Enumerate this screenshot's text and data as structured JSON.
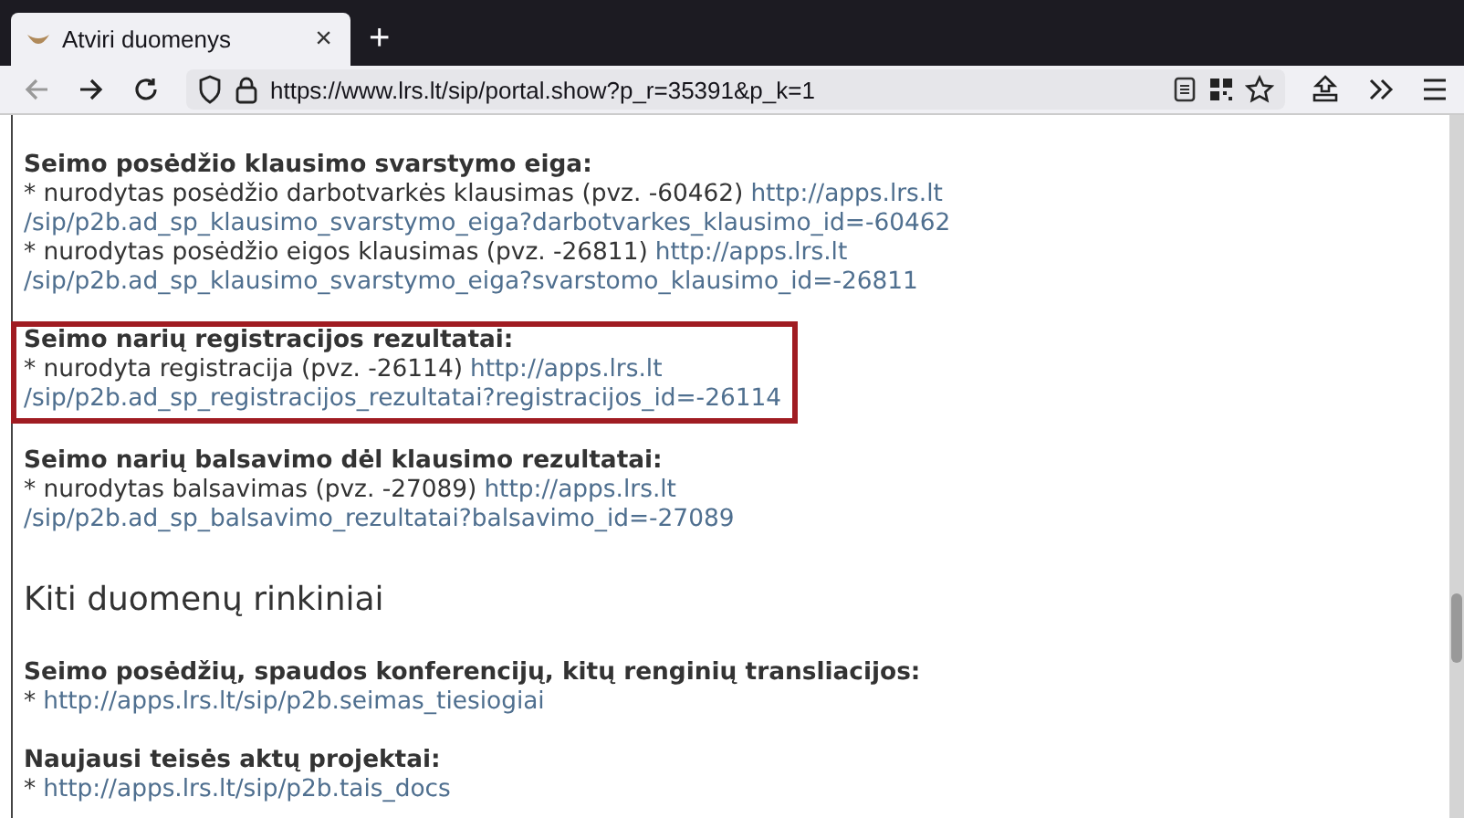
{
  "tab": {
    "title": "Atviri duomenys",
    "close": "×"
  },
  "new_tab": "+",
  "address_bar": {
    "url": "https://www.lrs.lt/sip/portal.show?p_r=35391&p_k=1"
  },
  "content": [
    {
      "kind": "section",
      "title": "Seimo posėdžio klausimo svarstymo eiga:",
      "items": [
        {
          "text": "* nurodytas posėdžio darbotvarkės klausimas (pvz. -60462)",
          "link_start": "http://apps.lrs.lt",
          "link_end": "/sip/p2b.ad_sp_klausimo_svarstymo_eiga?darbotvarkes_klausimo_id=-60462"
        },
        {
          "text": "* nurodytas posėdžio eigos klausimas (pvz. -26811)",
          "link_start": "http://apps.lrs.lt",
          "link_end": "/sip/p2b.ad_sp_klausimo_svarstymo_eiga?svarstomo_klausimo_id=-26811"
        }
      ]
    },
    {
      "kind": "framed_section",
      "title": "Seimo narių registracijos rezultatai:",
      "items": [
        {
          "text": "* nurodyta registracija (pvz. -26114)",
          "link_start": "http://apps.lrs.lt",
          "link_end": "/sip/p2b.ad_sp_registracijos_rezultatai?registracijos_id=-26114"
        }
      ]
    },
    {
      "kind": "section",
      "title": "Seimo narių balsavimo dėl klausimo rezultatai:",
      "items": [
        {
          "text": "* nurodytas balsavimas (pvz. -27089)",
          "link_start": "http://apps.lrs.lt",
          "link_end": "/sip/p2b.ad_sp_balsavimo_rezultatai?balsavimo_id=-27089"
        }
      ]
    },
    {
      "kind": "heading",
      "title": "Kiti duomenų rinkiniai"
    },
    {
      "kind": "section",
      "title": "Seimo posėdžių, spaudos konferencijų, kitų renginių transliacijos:",
      "items": [
        {
          "text": "*",
          "link_start": "http://apps.lrs.lt/sip/p2b.seimas_tiesiogiai"
        }
      ]
    },
    {
      "kind": "section",
      "title": "Naujausi teisės aktų projektai:",
      "items": [
        {
          "text": "*",
          "link_start": "http://apps.lrs.lt/sip/p2b.tais_docs"
        }
      ]
    }
  ]
}
